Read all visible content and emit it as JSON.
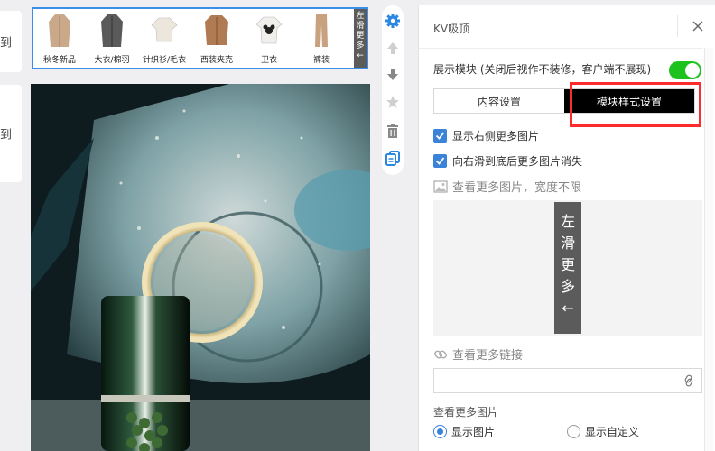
{
  "left_cards": [
    {
      "text": "到"
    },
    {
      "text": "到"
    }
  ],
  "category_strip": {
    "items": [
      {
        "label": "秋冬新品",
        "color": "#c9a98a"
      },
      {
        "label": "大衣/棉羽",
        "color": "#5a5a5a"
      },
      {
        "label": "针织衫/毛衣",
        "color": "#ece6dc"
      },
      {
        "label": "西装夹克",
        "color": "#b07a52"
      },
      {
        "label": "卫衣",
        "color": "#f1efec"
      },
      {
        "label": "裤装",
        "color": "#c8a27e"
      }
    ],
    "more_label_chars": [
      "左",
      "滑",
      "更",
      "多",
      "←"
    ]
  },
  "toolbar": {
    "icons": [
      "gear-icon",
      "arrow-up-icon",
      "arrow-down-icon",
      "star-icon",
      "trash-icon",
      "copy-icon"
    ]
  },
  "panel": {
    "title": "KV吸顶",
    "show_module_label": "展示模块 (关闭后视作不装修，客户端不展现)",
    "show_module_on": true,
    "tabs": [
      {
        "label": "内容设置",
        "active": false
      },
      {
        "label": "模块样式设置",
        "active": true
      }
    ],
    "checkbox_show_more": "显示右侧更多图片",
    "checkbox_hide_on_scroll": "向右滑到底后更多图片消失",
    "more_image_hint": "查看更多图片，宽度不限",
    "preview_chars": [
      "左",
      "滑",
      "更",
      "多",
      "←"
    ],
    "more_link_label": "查看更多链接",
    "more_link_value": "",
    "more_image_section": "查看更多图片",
    "radio_show_image": "显示图片",
    "radio_show_custom": "显示自定义"
  },
  "colors": {
    "accent": "#3b82d9",
    "toggle_on": "#1ec21e",
    "highlight": "#ff2a2a",
    "tag_bg": "#5b5b5b"
  }
}
